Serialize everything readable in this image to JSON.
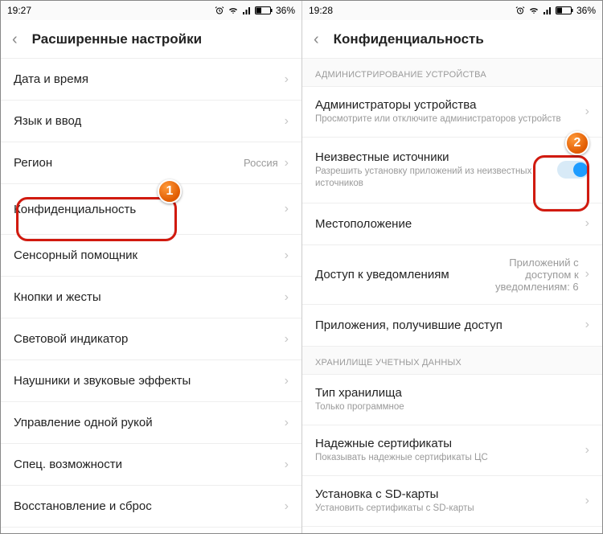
{
  "left": {
    "status": {
      "time": "19:27",
      "battery": "36%"
    },
    "header": {
      "title": "Расширенные настройки"
    },
    "rows": {
      "dateTime": "Дата и время",
      "langInput": "Язык и ввод",
      "region": "Регион",
      "regionValue": "Россия",
      "privacy": "Конфиденциальность",
      "touchAssist": "Сенсорный помощник",
      "buttonsGestures": "Кнопки и жесты",
      "led": "Световой индикатор",
      "headphones": "Наушники и звуковые эффекты",
      "oneHand": "Управление одной рукой",
      "accessibility": "Спец. возможности",
      "backupReset": "Восстановление и сброс"
    }
  },
  "right": {
    "status": {
      "time": "19:28",
      "battery": "36%"
    },
    "header": {
      "title": "Конфиденциальность"
    },
    "sectionAdmin": "АДМИНИСТРИРОВАНИЕ УСТРОЙСТВА",
    "adminRow": {
      "label": "Администраторы устройства",
      "sub": "Просмотрите или отключите администраторов устройств"
    },
    "unknownRow": {
      "label": "Неизвестные источники",
      "sub": "Разрешить установку приложений из неизвестных источников"
    },
    "location": "Местоположение",
    "notifAccess": {
      "label": "Доступ к уведомлениям",
      "value": "Приложений с доступом к уведомлениям: 6"
    },
    "appsAccess": "Приложения, получившие доступ",
    "sectionCred": "ХРАНИЛИЩЕ УЧЕТНЫХ ДАННЫХ",
    "storageType": {
      "label": "Тип хранилища",
      "sub": "Только программное"
    },
    "trustedCerts": {
      "label": "Надежные сертификаты",
      "sub": "Показывать надежные сертификаты ЦС"
    },
    "installSd": {
      "label": "Установка с SD-карты",
      "sub": "Установить сертификаты с SD-карты"
    }
  },
  "callouts": {
    "one": "1",
    "two": "2"
  }
}
